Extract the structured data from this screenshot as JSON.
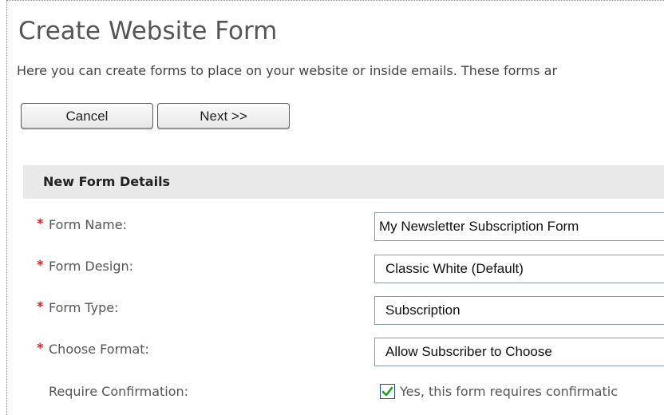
{
  "page": {
    "title": "Create Website Form",
    "intro": "Here you can create forms to place on your website or inside emails. These forms ar"
  },
  "buttons": {
    "cancel": "Cancel",
    "next": "Next >>"
  },
  "section": {
    "heading": "New Form Details"
  },
  "form": {
    "required_marker": "*",
    "name": {
      "label": "Form Name:",
      "value": "My Newsletter Subscription Form"
    },
    "design": {
      "label": "Form Design:",
      "value": "Classic White (Default)"
    },
    "type": {
      "label": "Form Type:",
      "value": "Subscription"
    },
    "format": {
      "label": "Choose Format:",
      "value": "Allow Subscriber to Choose"
    },
    "confirmation": {
      "label": "Require Confirmation:",
      "checkbox_label": "Yes, this form requires confirmatic",
      "checked": true
    }
  },
  "colors": {
    "required": "#dd2222",
    "section_bg": "#e9e9e9",
    "field_border": "#7f9db9",
    "check_mark": "#21a121"
  },
  "icons": {
    "check": "checkmark-icon"
  }
}
